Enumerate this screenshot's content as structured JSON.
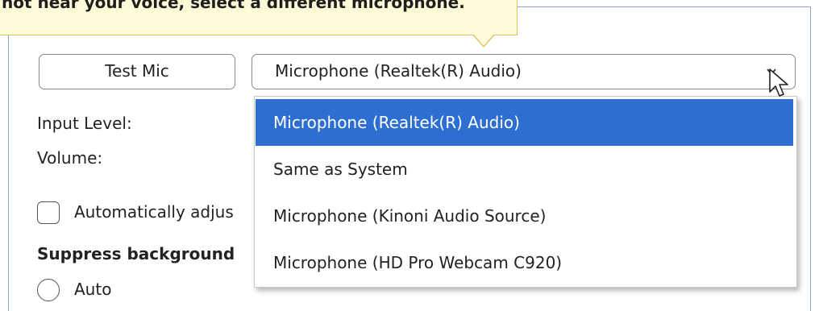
{
  "tooltip": {
    "text": "not hear your voice, select a different microphone."
  },
  "test_mic_button": {
    "label": "Test Mic"
  },
  "microphone_select": {
    "selected": "Microphone (Realtek(R) Audio)",
    "options": [
      "Microphone (Realtek(R) Audio)",
      "Same as System",
      "Microphone (Kinoni Audio Source)",
      "Microphone (HD Pro Webcam C920)"
    ],
    "highlighted_index": 0
  },
  "labels": {
    "input_level": "Input Level:",
    "volume": "Volume:",
    "auto_adjust": "Automatically adjus",
    "suppress_heading": "Suppress background",
    "auto": "Auto"
  },
  "colors": {
    "selection_bg": "#2d6ed1",
    "tooltip_bg": "#fdfbd8",
    "tooltip_border": "#d8c26a",
    "frame_border": "#8aa6d6"
  },
  "icons": {
    "dropdown_arrow": "chevron-down-icon",
    "cursor": "mouse-pointer-icon"
  },
  "state": {
    "auto_adjust_checked": false,
    "auto_radio_selected": false
  }
}
